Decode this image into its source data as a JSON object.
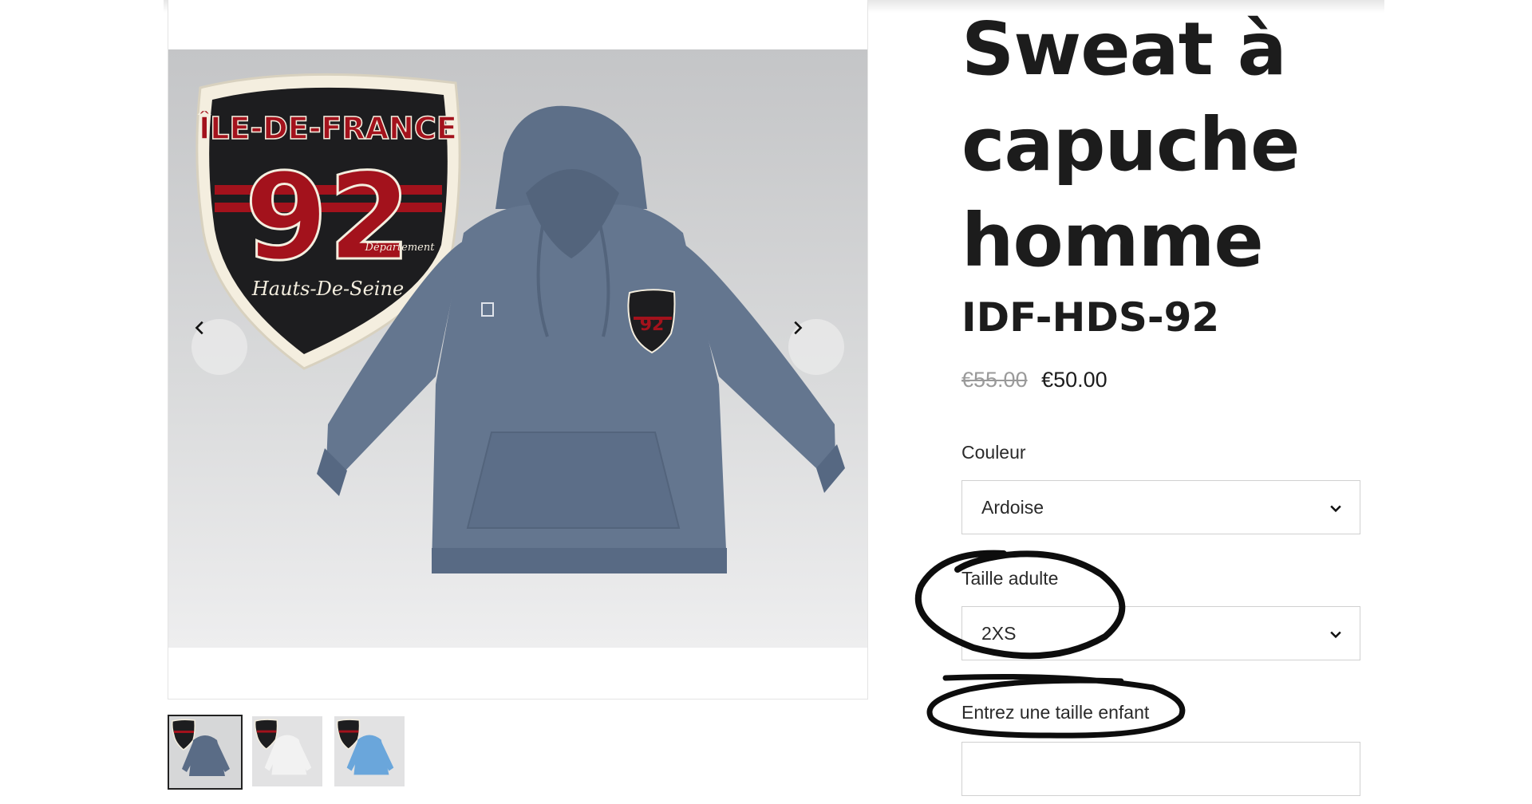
{
  "product": {
    "title": "Sweat à capuche homme",
    "sku": "IDF-HDS-92",
    "price_original": "€55.00",
    "price_current": "€50.00"
  },
  "badge": {
    "top_text": "ÎLE-DE-FRANCE",
    "number": "92",
    "tag": "Département",
    "bottom_text": "Hauts-De-Seine"
  },
  "options": {
    "color_label": "Couleur",
    "color_value": "Ardoise",
    "size_label": "Taille adulte",
    "size_value": "2XS",
    "child_size_label": "Entrez une taille enfant",
    "child_size_value": ""
  },
  "gallery": {
    "thumbnails": [
      {
        "color": "#5a6c86"
      },
      {
        "color": "#e8e8e8"
      },
      {
        "color": "#6aa6db"
      }
    ],
    "hoodie_color": "#64768f",
    "icons": {
      "prev": "chevron-left-icon",
      "next": "chevron-right-icon",
      "select": "chevron-down-icon"
    }
  },
  "colors": {
    "badge_red": "#a3121c",
    "badge_black": "#1d1d1f",
    "badge_cream": "#f4eedf",
    "annotation": "#0d0d0d"
  }
}
